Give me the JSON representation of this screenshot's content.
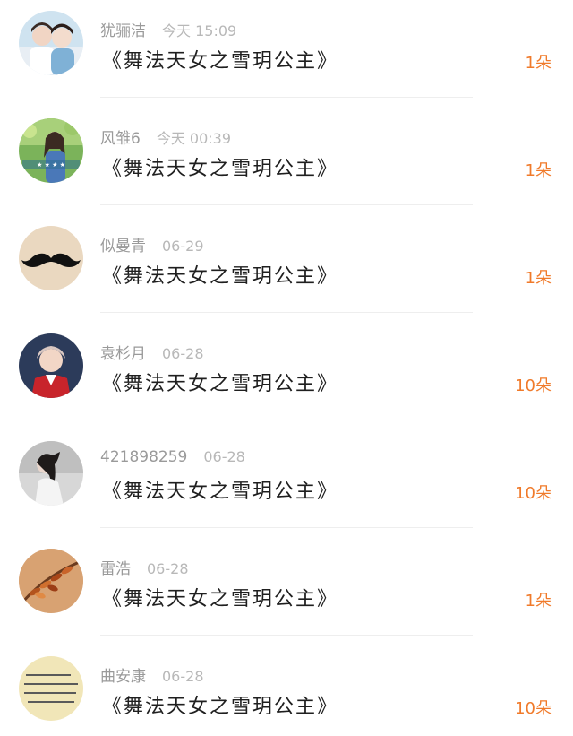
{
  "gift_list": {
    "items": [
      {
        "username": "犹骊洁",
        "time": "今天 15:09",
        "gift": "《舞法天女之雪玥公主》",
        "count": "1朵",
        "avatar": "avatar-two-boys-photo"
      },
      {
        "username": "风雏6",
        "time": "今天 00:39",
        "gift": "《舞法天女之雪玥公主》",
        "count": "1朵",
        "avatar": "avatar-girl-in-forest-photo"
      },
      {
        "username": "似曼青",
        "time": "06-29",
        "gift": "《舞法天女之雪玥公主》",
        "count": "1朵",
        "avatar": "avatar-mustache"
      },
      {
        "username": "袁杉月",
        "time": "06-28",
        "gift": "《舞法天女之雪玥公主》",
        "count": "10朵",
        "avatar": "avatar-boy-red-jacket-photo"
      },
      {
        "username": "421898259",
        "time": "06-28",
        "gift": "《舞法天女之雪玥公主》",
        "count": "10朵",
        "avatar": "avatar-girl-ponytail-photo"
      },
      {
        "username": "雷浩",
        "time": "06-28",
        "gift": "《舞法天女之雪玥公主》",
        "count": "1朵",
        "avatar": "avatar-autumn-leaves-photo"
      },
      {
        "username": "曲安康",
        "time": "06-28",
        "gift": "《舞法天女之雪玥公主》",
        "count": "10朵",
        "avatar": "avatar-text-note-image"
      }
    ]
  },
  "colors": {
    "count_accent": "#f07a2a",
    "username_gray": "#9a9a9a",
    "divider": "#eeeeee"
  }
}
